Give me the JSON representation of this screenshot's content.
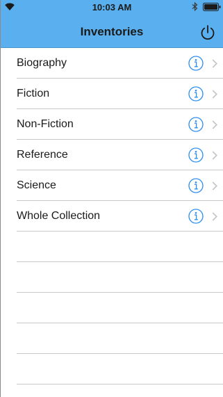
{
  "status_bar": {
    "time": "10:03 AM"
  },
  "nav": {
    "title": "Inventories",
    "power_icon": "power-icon"
  },
  "colors": {
    "header_bg": "#5ab0ee",
    "info_accent": "#2a8cf0",
    "separator": "#c9c9c9",
    "chevron": "#c4c4c4"
  },
  "inventories": [
    {
      "label": "Biography"
    },
    {
      "label": "Fiction"
    },
    {
      "label": "Non-Fiction"
    },
    {
      "label": "Reference"
    },
    {
      "label": "Science"
    },
    {
      "label": "Whole Collection"
    }
  ]
}
